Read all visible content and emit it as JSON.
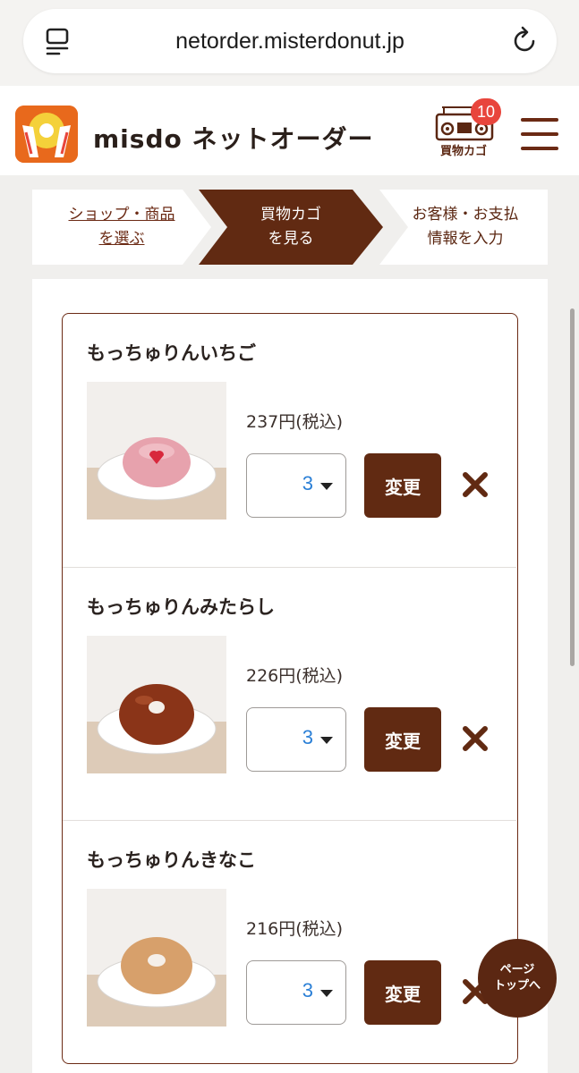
{
  "browser": {
    "url": "netorder.misterdonut.jp"
  },
  "header": {
    "brand": "misdo ネットオーダー",
    "cart_label": "買物カゴ",
    "cart_count": "10"
  },
  "steps": [
    {
      "label_line1": "ショップ・商品",
      "label_line2": "を選ぶ"
    },
    {
      "label_line1": "買物カゴ",
      "label_line2": "を見る"
    },
    {
      "label_line1": "お客様・お支払",
      "label_line2": "情報を入力"
    }
  ],
  "cart": {
    "items": [
      {
        "name": "もっちゅりんいちご",
        "price": "237円(税込)",
        "qty": "3",
        "change_label": "変更",
        "donut_color": "#e7a2ad"
      },
      {
        "name": "もっちゅりんみたらし",
        "price": "226円(税込)",
        "qty": "3",
        "change_label": "変更",
        "donut_color": "#8a3418"
      },
      {
        "name": "もっちゅりんきなこ",
        "price": "216円(税込)",
        "qty": "3",
        "change_label": "変更",
        "donut_color": "#d7a06b"
      }
    ]
  },
  "page_top": {
    "line1": "ページ",
    "line2": "トップへ"
  },
  "colors": {
    "brand_brown": "#612a12",
    "accent_orange": "#e8691c",
    "badge_red": "#e8453c",
    "qty_blue": "#2a7fd6"
  }
}
